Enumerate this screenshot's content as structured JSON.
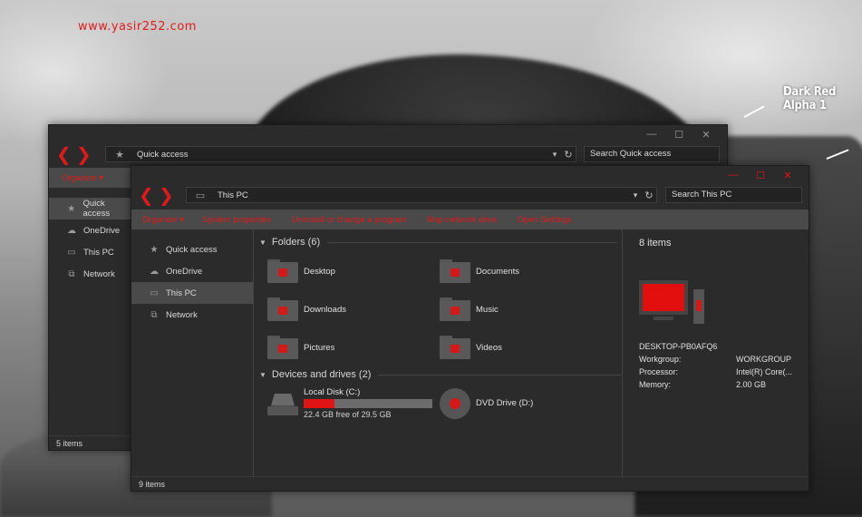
{
  "desktop": {
    "watermark": "www.yasir252.com",
    "theme_title": "Dark Red Alpha 1"
  },
  "back_window": {
    "address": "Quick access",
    "search_placeholder": "Search Quick access",
    "command": "Organize",
    "nav_items": [
      {
        "label": "Quick access",
        "icon": "star-icon",
        "selected": true
      },
      {
        "label": "OneDrive",
        "icon": "cloud-icon",
        "selected": false
      },
      {
        "label": "This PC",
        "icon": "computer-icon",
        "selected": false
      },
      {
        "label": "Network",
        "icon": "network-icon",
        "selected": false
      }
    ],
    "status": "5 items"
  },
  "front_window": {
    "address": "This PC",
    "search_placeholder": "Search This PC",
    "commands": [
      "Organize",
      "System properties",
      "Uninstall or change a program",
      "Map network drive",
      "Open Settings"
    ],
    "nav_items": [
      {
        "label": "Quick access",
        "icon": "star-icon",
        "selected": false
      },
      {
        "label": "OneDrive",
        "icon": "cloud-icon",
        "selected": false
      },
      {
        "label": "This PC",
        "icon": "computer-icon",
        "selected": true
      },
      {
        "label": "Network",
        "icon": "network-icon",
        "selected": false
      }
    ],
    "folders_header": "Folders (6)",
    "folders": [
      "Desktop",
      "Documents",
      "Downloads",
      "Music",
      "Pictures",
      "Videos"
    ],
    "drives_header": "Devices and drives (2)",
    "drives": [
      {
        "name": "Local Disk (C:)",
        "free": "22.4 GB free of 29.5 GB",
        "used_fraction": 0.24
      },
      {
        "name": "DVD Drive (D:)"
      }
    ],
    "details": {
      "title": "8 items",
      "computer_name": "DESKTOP-PB0AFQ6",
      "properties": [
        {
          "key": "Workgroup:",
          "value": "WORKGROUP"
        },
        {
          "key": "Processor:",
          "value": "Intel(R) Core(..."
        },
        {
          "key": "Memory:",
          "value": "2.00 GB"
        }
      ]
    },
    "status": "9 items"
  },
  "colors": {
    "accent": "#e01a1a",
    "window_bg": "#2b2b2b",
    "command_bar": "#4a4a4a"
  }
}
